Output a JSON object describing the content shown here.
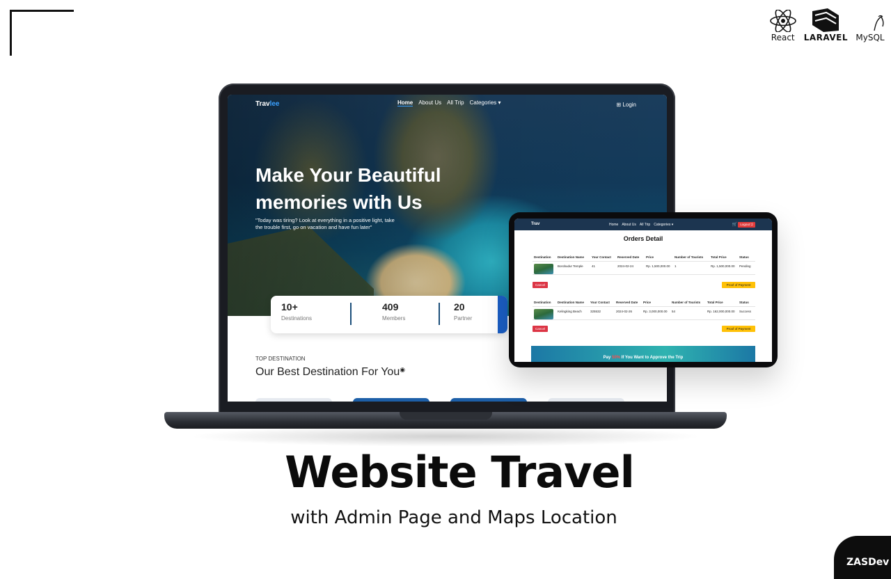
{
  "tech_stack": [
    {
      "name": "React",
      "icon": "react-icon"
    },
    {
      "name": "LARAVEL",
      "icon": "laravel-icon"
    },
    {
      "name": "MySQL",
      "icon": "mysql-icon"
    }
  ],
  "laptop_site": {
    "brand_main": "Trav",
    "brand_accent": "lee",
    "nav": [
      "Home",
      "About Us",
      "All Trip",
      "Categories ▾"
    ],
    "login": "⊞ Login",
    "hero_title": "Make Your Beautiful memories with Us",
    "hero_quote": "\"Today was tiring? Look at everything in a positive light, take the trouble first, go on vacation and have fun later\"",
    "stats": [
      {
        "value": "10+",
        "caption": "Destinations"
      },
      {
        "value": "409",
        "caption": "Members"
      },
      {
        "value": "20",
        "caption": "Partner"
      }
    ],
    "top_destination": "TOP DESTINATION",
    "best_destination": "Our Best Destination For You"
  },
  "tablet_site": {
    "brand": "Trav",
    "nav": [
      "Home",
      "About Us",
      "All Trip",
      "Categories ▾"
    ],
    "cart": "🛒",
    "logout": "Logout ⎋",
    "title": "Orders Detail",
    "headers_1": [
      "Destination",
      "Destination Name",
      "Your Contact",
      "Reserved Date",
      "Price",
      "Number of Tourists",
      "Total Price",
      "Status"
    ],
    "order_1": [
      "",
      "Borobudur Temple",
      "41",
      "2024-02-24",
      "Rp. 1,500,000.00",
      "1",
      "Rp. 1,500,000.00",
      "Pending"
    ],
    "headers_2": [
      "Destination",
      "Destination Name",
      "Your Contact",
      "Reserved Date",
      "Price",
      "Number of Tourists",
      "Total Price",
      "Status"
    ],
    "order_2": [
      "",
      "Kelingking Beach",
      "325532",
      "2024-02-26",
      "Rp. 3,000,000.00",
      "54",
      "Rp. 162,000,000.00",
      "Success"
    ],
    "cancel": "Cancel",
    "proof": "Proof of Payment",
    "pay_pre": "Pay ",
    "pay_pct": "50%",
    "pay_post": " If You Want to Approve the Trip"
  },
  "headline": "Website Travel",
  "subline": "with Admin Page and Maps Location",
  "badge": "ZASDev"
}
